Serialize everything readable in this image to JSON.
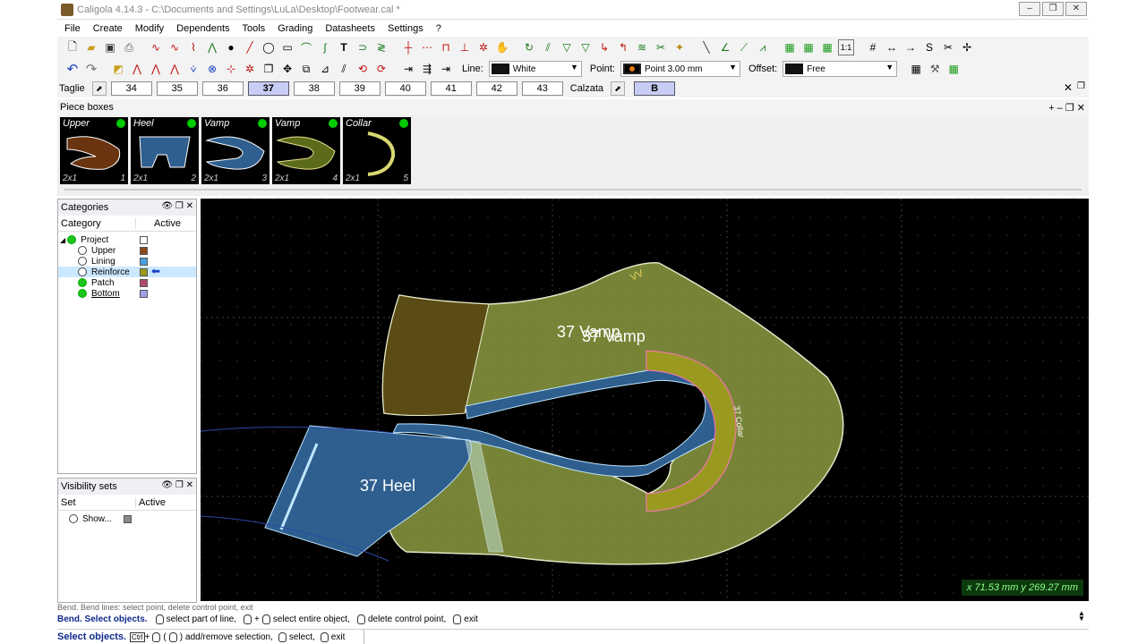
{
  "window": {
    "title": "Caligola 4.14.3 - C:\\Documents and Settings\\LuLa\\Desktop\\Footwear.cal *"
  },
  "menu": [
    "File",
    "Create",
    "Modify",
    "Dependents",
    "Tools",
    "Grading",
    "Datasheets",
    "Settings",
    "?"
  ],
  "toolbar2": {
    "line_label": "Line:",
    "line_value": "White",
    "point_label": "Point:",
    "point_value": "Point 3.00 mm",
    "offset_label": "Offset:",
    "offset_value": "Free"
  },
  "sizes": {
    "label": "Taglie",
    "values": [
      "34",
      "35",
      "36",
      "37",
      "38",
      "39",
      "40",
      "41",
      "42",
      "43"
    ],
    "active": "37",
    "calzata_label": "Calzata",
    "calzata_value": "B"
  },
  "piece_boxes": {
    "title": "Piece boxes",
    "items": [
      {
        "name": "Upper",
        "count": "2x1",
        "index": "1",
        "color": "#6b3410"
      },
      {
        "name": "Heel",
        "count": "2x1",
        "index": "2",
        "color": "#2e5e8e"
      },
      {
        "name": "Vamp",
        "count": "2x1",
        "index": "3",
        "color": "#2e5e8e"
      },
      {
        "name": "Vamp",
        "count": "2x1",
        "index": "4",
        "color": "#5b6b1a"
      },
      {
        "name": "Collar",
        "count": "2x1",
        "index": "5",
        "color": "#222222"
      }
    ]
  },
  "categories": {
    "title": "Categories",
    "col_category": "Category",
    "col_active": "Active",
    "items": [
      {
        "label": "Project",
        "swatch": "#ffffff",
        "on": true
      },
      {
        "label": "Upper",
        "swatch": "#8a4a1a",
        "on": false
      },
      {
        "label": "Lining",
        "swatch": "#4aa0e0",
        "on": false
      },
      {
        "label": "Reinforce",
        "swatch": "#9a9a20",
        "on": false
      },
      {
        "label": "Patch",
        "swatch": "#b04a6a",
        "on": true
      },
      {
        "label": "Bottom",
        "swatch": "#a0a0e8",
        "on": true
      }
    ]
  },
  "visibility_sets": {
    "title": "Visibility sets",
    "col_set": "Set",
    "col_active": "Active",
    "items": [
      {
        "label": "Show..."
      }
    ]
  },
  "canvas": {
    "labels": {
      "vamp1": "37 Vamp",
      "vamp2": "37 Vamp",
      "heel": "37 Heel",
      "collar": "37 Collar"
    },
    "coords": "x 71.53 mm  y 269.27 mm"
  },
  "status": {
    "ghost": "Bend. Bend lines: select point, delete control point, exit",
    "line1_bold": "Bend. Select objects.",
    "line1_a": "select part of line,",
    "line1_b": "select entire object,",
    "line1_c": "delete control point,",
    "line1_d": "exit",
    "line2_bold": "Select objects.",
    "line2_a": "add/remove selection,",
    "line2_b": "select,",
    "line2_c": "exit"
  },
  "colors": {
    "vamp_fill": "#7e8c3a",
    "heel_fill": "#2f5f8f",
    "collar_fill": "#9a9a20",
    "canvas_bg": "#000000"
  }
}
